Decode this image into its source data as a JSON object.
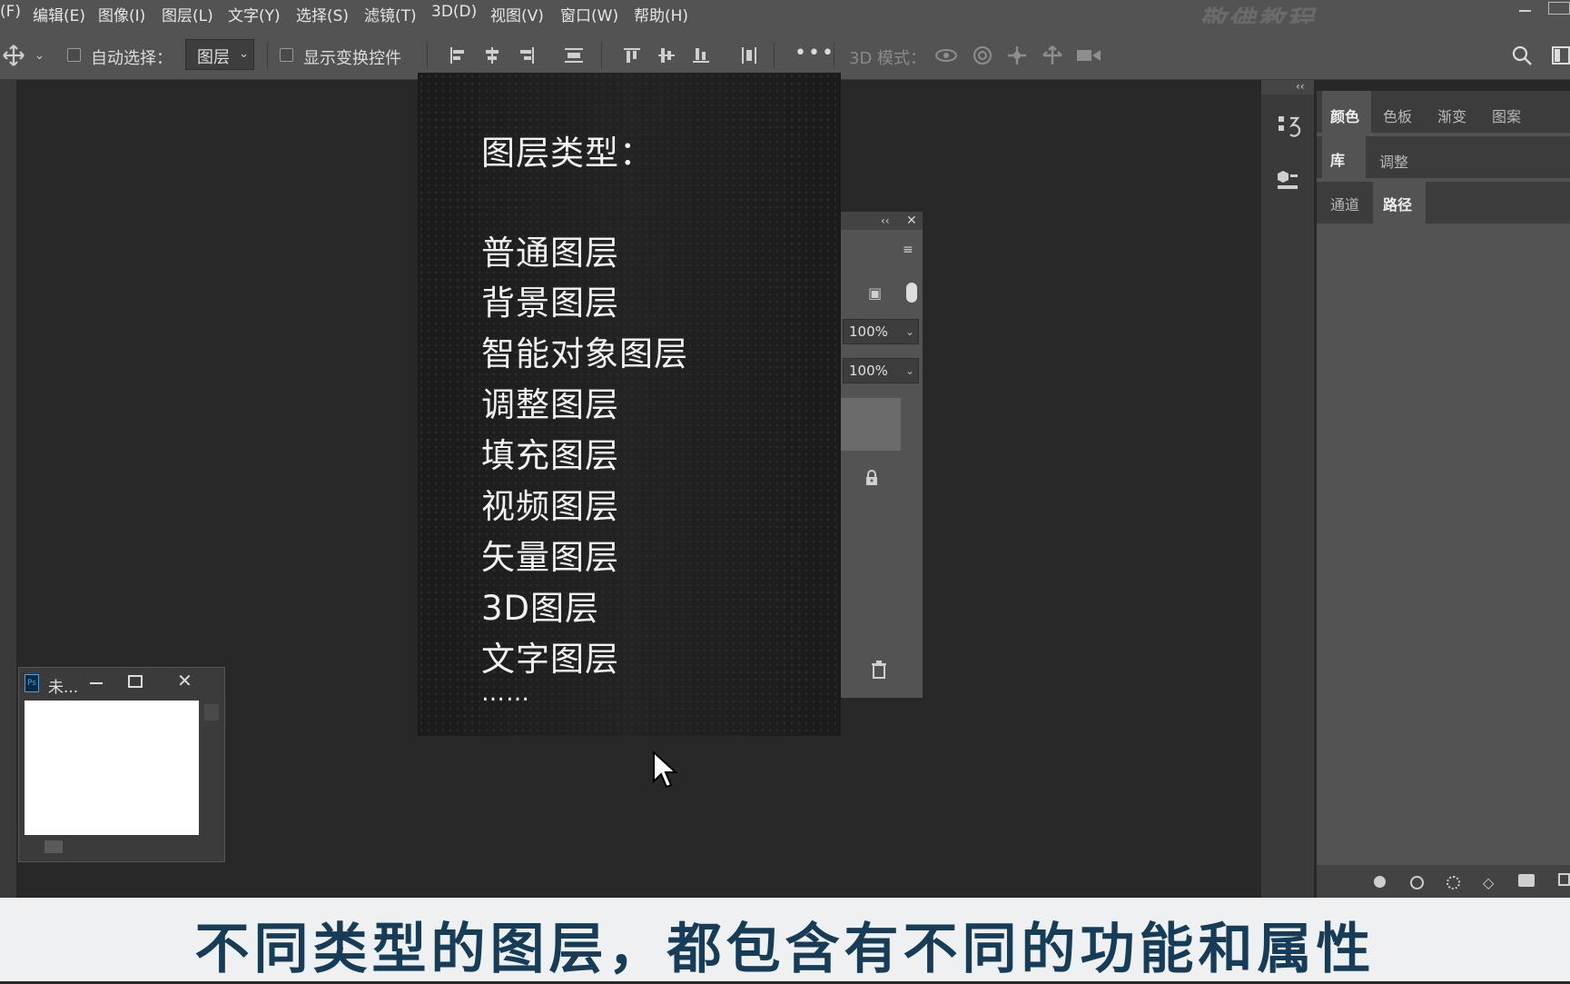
{
  "menu": {
    "items": [
      "(F)",
      "编辑(E)",
      "图像(I)",
      "图层(L)",
      "文字(Y)",
      "选择(S)",
      "滤镜(T)",
      "3D(D)",
      "视图(V)",
      "窗口(W)",
      "帮助(H)"
    ],
    "watermark": "敬佛教程"
  },
  "options": {
    "auto_select_label": "自动选择：",
    "auto_select_value": "图层",
    "show_transform_label": "显示变换控件",
    "three_d_mode_label": "3D 模式：",
    "more": "•••"
  },
  "slide": {
    "title": "图层类型：",
    "items": [
      "普通图层",
      "背景图层",
      "智能对象图层",
      "调整图层",
      "填充图层",
      "视频图层",
      "矢量图层",
      "3D图层",
      "文字图层",
      "……"
    ]
  },
  "layers_panel": {
    "opacity": "100%",
    "fill": "100%"
  },
  "mini_window": {
    "title": "未...",
    "icon": "Ps"
  },
  "right_panel": {
    "row1": [
      "颜色",
      "色板",
      "渐变",
      "图案"
    ],
    "row2": [
      "库",
      "调整"
    ],
    "row3": [
      "通道",
      "路径"
    ]
  },
  "subtitle": "不同类型的图层，都包含有不同的功能和属性",
  "icons": [
    "move-icon",
    "align-left-icon",
    "align-center-icon",
    "align-right-icon",
    "distribute-icon",
    "align-top-icon",
    "align-middle-icon",
    "align-bottom-icon",
    "orbit-icon",
    "roll-icon",
    "pan-icon",
    "slide-icon",
    "camera-icon",
    "search-icon",
    "lock-icon",
    "trash-icon"
  ]
}
